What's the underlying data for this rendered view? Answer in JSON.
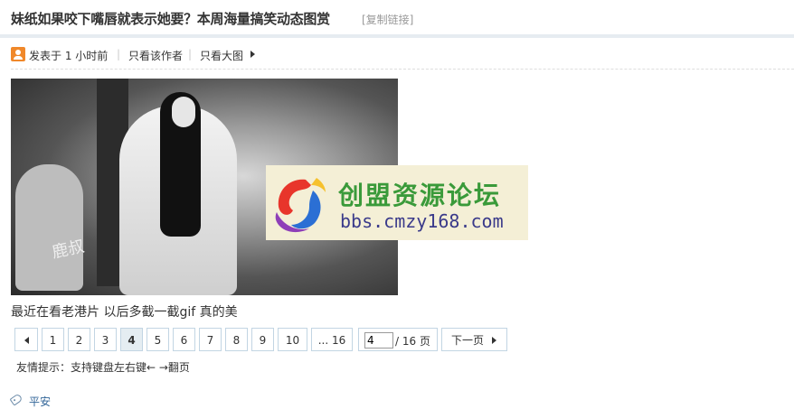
{
  "thread": {
    "title": "妹纸如果咬下嘴唇就表示她要？本周海量搞笑动态图赏",
    "copy_link": "[复制链接]"
  },
  "meta": {
    "posted": "发表于 1 小时前",
    "separator": "|",
    "only_author": "只看该作者",
    "only_big_image": "只看大图"
  },
  "watermark": {
    "name": "创盟资源论坛",
    "url": "bbs.cmzy168.com"
  },
  "photo": {
    "stamp_text": "鹿叔"
  },
  "caption": "最近在看老港片 以后多截一截gif 真的美",
  "pager": {
    "pages": [
      "1",
      "2",
      "3",
      "4",
      "5",
      "6",
      "7",
      "8",
      "9",
      "10"
    ],
    "current": "4",
    "last": "... 16",
    "jump_value": "4",
    "total": "/ 16 页",
    "next": "下一页"
  },
  "tip": "友情提示：支持键盘左右键← →翻页",
  "tags": [
    "平安"
  ],
  "colors": {
    "border": "#c2d5e3",
    "current_bg": "#e5edf2",
    "title_underline": "#e6ecf1",
    "watermark_bg": "#f4efd6",
    "watermark_green": "#3a9a3a",
    "watermark_blue": "#3a3a8a"
  }
}
